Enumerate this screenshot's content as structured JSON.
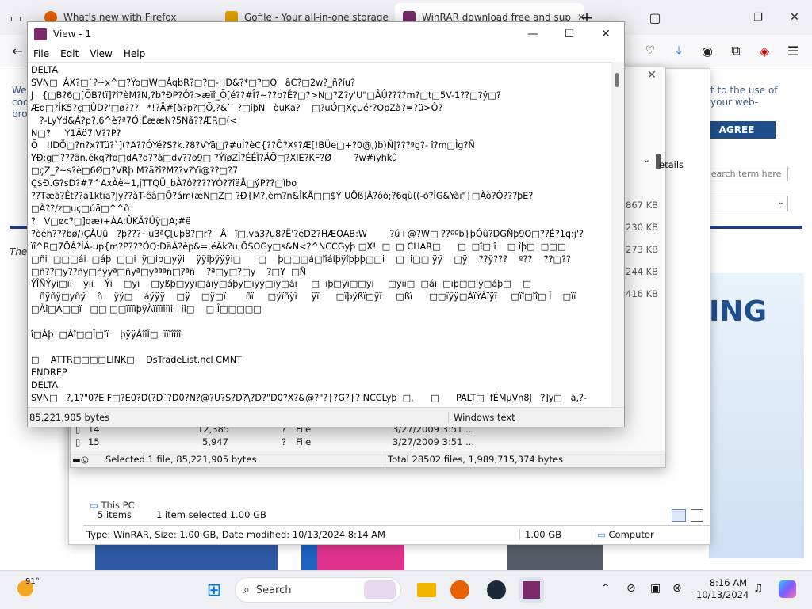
{
  "firefox": {
    "tabs": [
      {
        "title": "What's new with Firefox"
      },
      {
        "title": "Gofile - Your all-in-one storage"
      },
      {
        "title": "WinRAR download free and sup"
      }
    ],
    "new_tab": "+"
  },
  "website": {
    "cookie_text_1": "t to the use of",
    "cookie_text_2": "your web-",
    "left_text_1": "We",
    "left_text_2": "coo",
    "left_text_3": "bro",
    "agree_label": "AGREE",
    "search_placeholder": "search term here",
    "italic_text": "The",
    "banner_text": "ING",
    "details_label": "etails"
  },
  "winrar_window": {
    "file_rows": [
      {
        "name": "14",
        "size": "12,385",
        "packed": "?",
        "type": "File",
        "modified": "3/27/2009 3:51 ..."
      },
      {
        "name": "15",
        "size": "5,947",
        "packed": "?",
        "type": "File",
        "modified": "3/27/2009 3:51 ..."
      }
    ],
    "size_column": [
      "867 KB",
      "230 KB",
      "273 KB",
      "244 KB",
      "416 KB"
    ],
    "status_left": "Selected 1 file, 85,221,905 bytes",
    "status_right": "Total 28502 files, 1,989,715,374 bytes"
  },
  "explorer": {
    "tree_item": "This PC",
    "status_items": "5 items",
    "status_selected": "1 item selected  1.00 GB",
    "details_text": "Type: WinRAR, Size: 1.00 GB, Date modified: 10/13/2024 8:14 AM",
    "details_size": "1.00 GB",
    "details_location": "Computer"
  },
  "view_window": {
    "title": "View - 1",
    "menu": [
      "File",
      "Edit",
      "View",
      "Help"
    ],
    "content_lines": [
      "DELTA",
      "SVN□  ÂX?□`?~x^□?Ýo□W□ÂqbR?□?□-HÐ&?*□?□Q   âC?□2w?_ñ?íu?",
      "J   {□B?6□[ÕB?tï]?î?èM?N,?b?ÐP?Ô?>æïî_Õ[é??#Î?~??p?É?□?>N□?Z?y'U\"□ÂÛ????m?□t□5V-1??□?ý□?",
      "Æq□?ÍK5?ç□ÛD?'□ø???   *!?Ä#[à?p?□Õ,?&`  ?□îþN   òuKa?    □?uÓ□XçUér?OpZà?=?ü>Ô?",
      "   ?-LyYd&Á?p?,6^è?ª7Ó;ËææN?5Nã??ÆR□(<",
      "N□?     Ý1Ãö7IV??P?",
      "Õ   !IDÖ□?n?x?Tü?`](?A??ÓYé?S?k.?8?VÝä□?#uÍ?èC{??Ô?Xº?Æ[!BÜe□+?0@,)b)Ñ|???ªg?- î?m□Ìg?Ñ",
      "YÐ:g□???ân.ékq?fo□dA?d??à□dv??ö9□ ?ÝîøZÍ?ÉÉÏ?ÄÕ□?XIE?KF?Ø        ?w#ïÿhkû",
      "□çZ_?~s?è□6Ø□?VRþ M?ä?î?M??v?Yï@??□?7",
      "Ç$Ð.G?sD?#7^AxÀè~1,jTTQÜ_bÀ?ô????YÓ??îäÅ□ýP??□ìbo",
      "??Tæà?Êt??ä1ktïä?Jy??àT-êâ□Ô?ám(æN□Z□ ?Ð{M?,èm?n&ÎKÃ□□$Ý UÖß]Â?ôò;?6qù((-ó?ÌG&Yàï\"}□Àò?Ò???þE?",
      "□Ã??/z□uç□úä□^^õ",
      "?   V□øc?□]qæ)+ÀA:ÛKÃ?Üÿ□A;#ë",
      "?òéh???bø/)ÇÀUû   ?þ???~ü3ªÇ[üþ8?□r?   Â   î□,vä3?ü8?Ë'?éD2?HÆOAB:W        ?ú+@?W□ ??ººb}þÓû?DGÑþ9O□??É?1q:j'?",
      "ïî^R□7ÕÂ?ÎÄ-up{m?P???ÓQ:ÐäÃ?èp&=,ëÃk?u;ÕSOGy□s&N<?^NCCGyþ □X!  □  □ CHAR□      □  □î□ î    □ îþ□  □□□",
      "□ñi  □□□ái  □áþ  □□i  ÿ□iþ□yÿi    ÿÿiþÿÿÿi□      □    þ□□□á□îîáíþÿîþþþ□□i    □  i□□ ÿÿ    □ÿ    ??ÿ???    º??    ??□??",
      "□ñ??□y??ñy□ñÿÿª□ñyª□yªªªñ□?ªñ    ?ª□y□?□y    ?□Y  □Ñ",
      "ÝÎÑÝÿi□ïï    ÿïi    Ýi    □ÿi    □yßþ□ÿÿï□áïÿ□áþÿ□ïÿÿ□ïÿ□áï     □  ïþ□ÿï□□ÿi     □ÿïï□  □áï  □ïþ□□ïÿ□áþ□    □",
      "   ñÿñÿ□yñÿ    ñ    ÿÿ□    áÿÿÿ    □ÿ    □ÿ□ï       ñï     □ÿïñÿï     ÿï      □ïþÿßï□ÿï     □ßï      □□ïÿÿ□ÁïÝÁïÿï     □ïî□îî□ Î    □ïï",
      "□Àî□Á□□ï   □□ □□ïïïïþÿÄïïïïîîïî   îî□    □ Î□□□□□",
      "",
      "î□Áþ  □Áî□□Î□îï    þÿÿÁîîÎ□  ïïîîîîî",
      "",
      "□    ATTR□□□□LINK□    DsTradeList.ncl CMNT",
      "ENDREP",
      "DELTA",
      "SVN□   ?,1?\"0?E F□?E0?D(?D`?D0?N?@?U?S?D?\\?D?\"D0?X?&@?\"?}?G?}? NCCLyþ  □,      □      PALT□  fÉMµVn8J   ?]y□   a,?-"
    ],
    "status_size": "85,221,905 bytes",
    "status_encoding": "Windows text"
  },
  "taskbar": {
    "weather_temp": "91°",
    "search_label": "Search",
    "time": "8:16 AM",
    "date": "10/13/2024"
  }
}
